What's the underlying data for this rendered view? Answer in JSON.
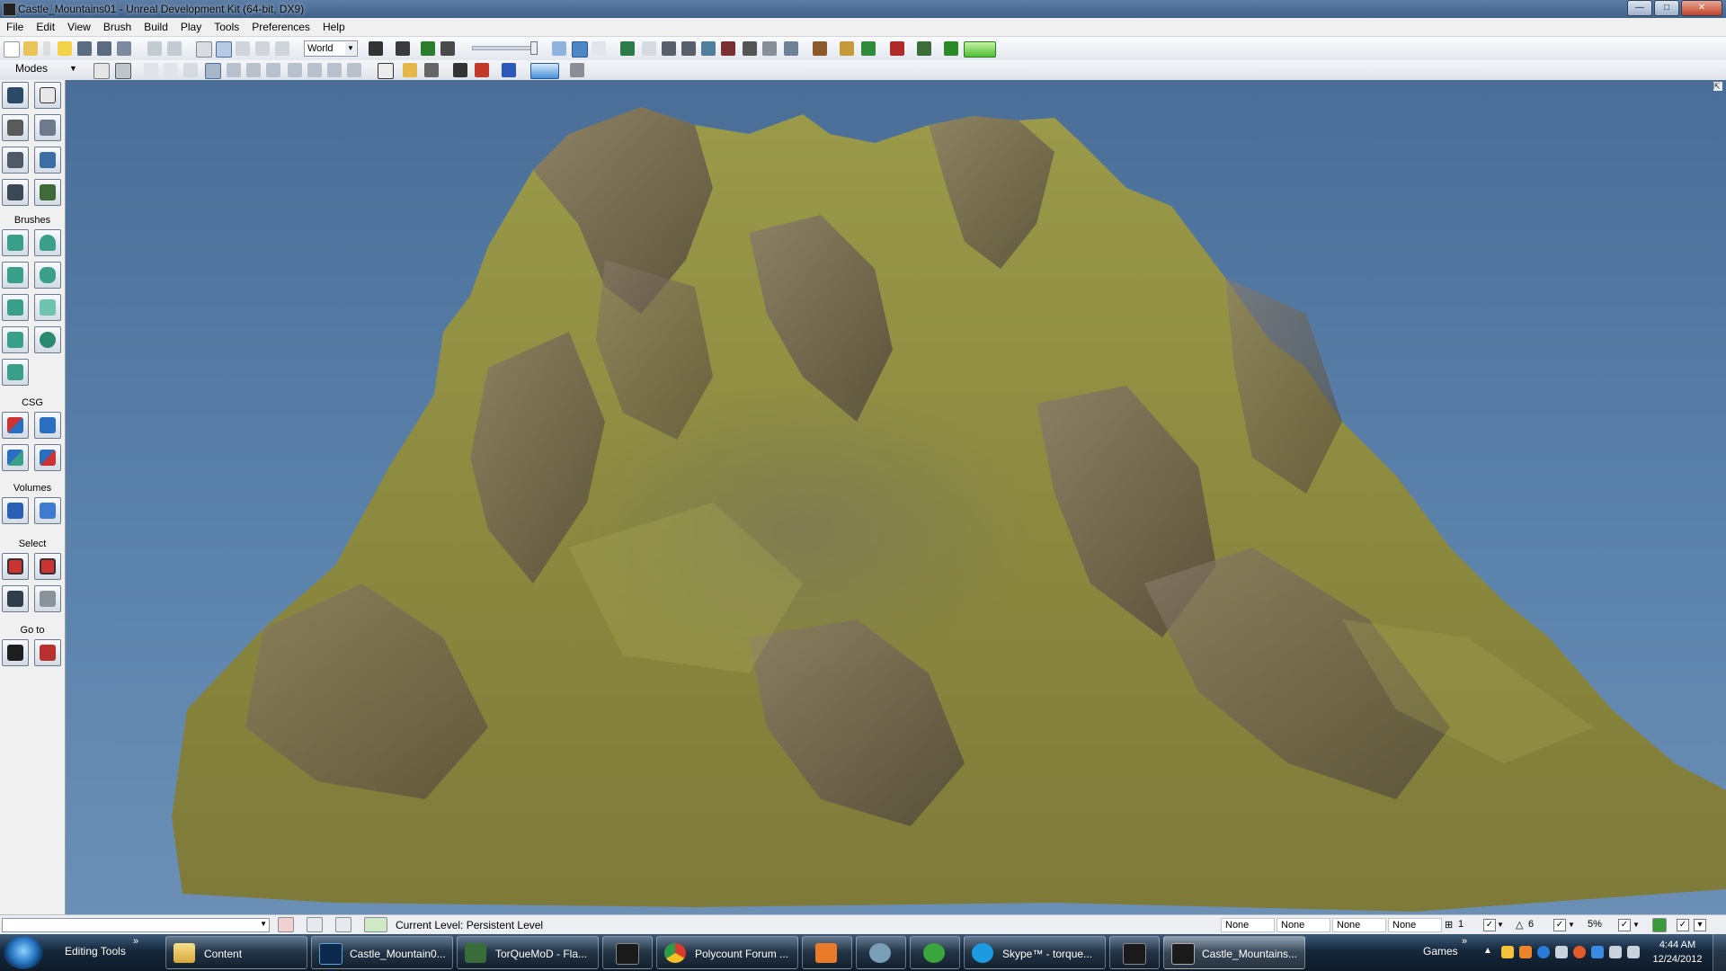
{
  "window": {
    "title": "Castle_Mountains01 - Unreal Development Kit (64-bit, DX9)",
    "controls": {
      "minimize": "—",
      "maximize": "□",
      "close": "✕"
    }
  },
  "menu": [
    "File",
    "Edit",
    "View",
    "Brush",
    "Build",
    "Play",
    "Tools",
    "Preferences",
    "Help"
  ],
  "toolbar": {
    "coordinate_system": "World"
  },
  "sidebar": {
    "modes_label": "Modes",
    "sections": {
      "brushes": "Brushes",
      "csg": "CSG",
      "volumes": "Volumes",
      "select": "Select",
      "goto": "Go to"
    }
  },
  "statusbar": {
    "current_level_label": "Current Level:",
    "current_level_value": "Persistent Level",
    "fields": [
      "None",
      "None",
      "None",
      "None"
    ],
    "grid_value": "1",
    "rotation_snap": "6",
    "scale_snap": "5%"
  },
  "taskbar": {
    "editing_tools": "Editing Tools",
    "chevron": "»",
    "buttons": [
      {
        "label": "Content",
        "icon": "folder-icon"
      },
      {
        "label": "Castle_Mountain0...",
        "icon": "photoshop-icon"
      },
      {
        "label": "TorQueMoD - Fla...",
        "icon": "flash-icon"
      },
      {
        "label": "",
        "icon": "udk-icon"
      },
      {
        "label": "Polycount Forum ...",
        "icon": "chrome-icon"
      },
      {
        "label": "",
        "icon": "mail-icon"
      },
      {
        "label": "",
        "icon": "network-icon"
      },
      {
        "label": "",
        "icon": "utorrent-icon"
      },
      {
        "label": "Skype™ - torque...",
        "icon": "skype-icon"
      },
      {
        "label": "",
        "icon": "udk-icon"
      },
      {
        "label": "Castle_Mountains...",
        "icon": "udk-icon"
      }
    ],
    "games": "Games",
    "clock_time": "4:44 AM",
    "clock_date": "12/24/2012"
  },
  "colors": {
    "viewport_sky": "#5a80aa",
    "terrain_grass": "#8a8a3e",
    "terrain_rock": "#6b5e4e",
    "taskbar": "#16283b"
  }
}
